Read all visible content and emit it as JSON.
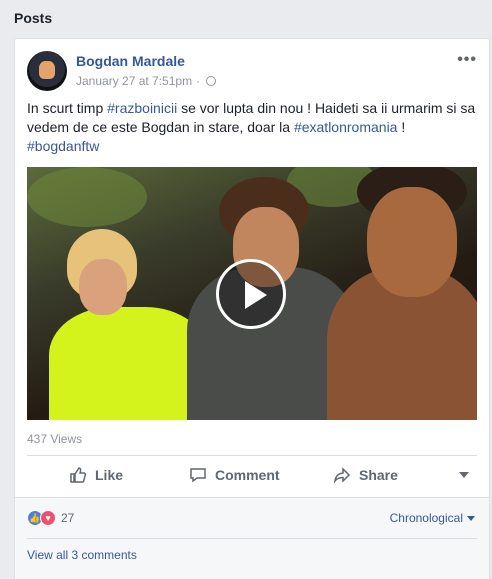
{
  "section": {
    "title": "Posts"
  },
  "post": {
    "author": "Bogdan Mardale",
    "timestamp": "January 27 at 7:51pm",
    "separator": "·",
    "more_label": "•••",
    "text": {
      "p1": "In scurt timp ",
      "tag1": "#razboinicii",
      "p2": " se vor lupta din nou ! Haideti sa ii urmarim si sa vedem de ce este Bogdan in stare, doar la ",
      "tag2": "#exatlonromania",
      "p3": " !",
      "tag3": "#bogdanftw"
    },
    "views": "437 Views",
    "actions": {
      "like": "Like",
      "comment": "Comment",
      "share": "Share"
    },
    "reactions": {
      "count": "27",
      "like_icon": "thumbs-up",
      "love_icon": "heart"
    },
    "sort": "Chronological",
    "view_all_comments": "View all 3 comments"
  },
  "colors": {
    "link": "#365899",
    "muted": "#90949c",
    "background": "#e9ebee"
  }
}
